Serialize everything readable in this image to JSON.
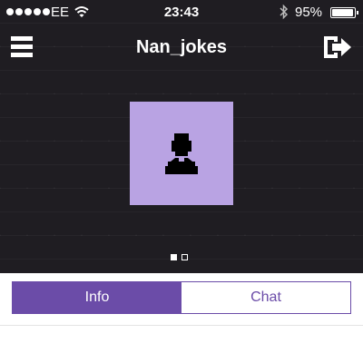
{
  "status_bar": {
    "carrier": "EE",
    "time": "23:43",
    "battery": "95%",
    "battery_level": 0.95,
    "icons": [
      "signal-dots",
      "wifi-icon",
      "bluetooth-icon",
      "battery-icon"
    ]
  },
  "header": {
    "title": "Nan_jokes",
    "menu_icon": "hamburger-menu-icon",
    "logout_icon": "logout-icon"
  },
  "profile": {
    "avatar_icon": "person-silhouette-icon",
    "page_count": 2,
    "current_page": 1
  },
  "tabs": [
    {
      "label": "Info",
      "active": true
    },
    {
      "label": "Chat",
      "active": false
    }
  ],
  "colors": {
    "accent": "#6b4ca8",
    "avatar_bg": "#b9a3e3",
    "hero_bg": "#1f1d22"
  }
}
